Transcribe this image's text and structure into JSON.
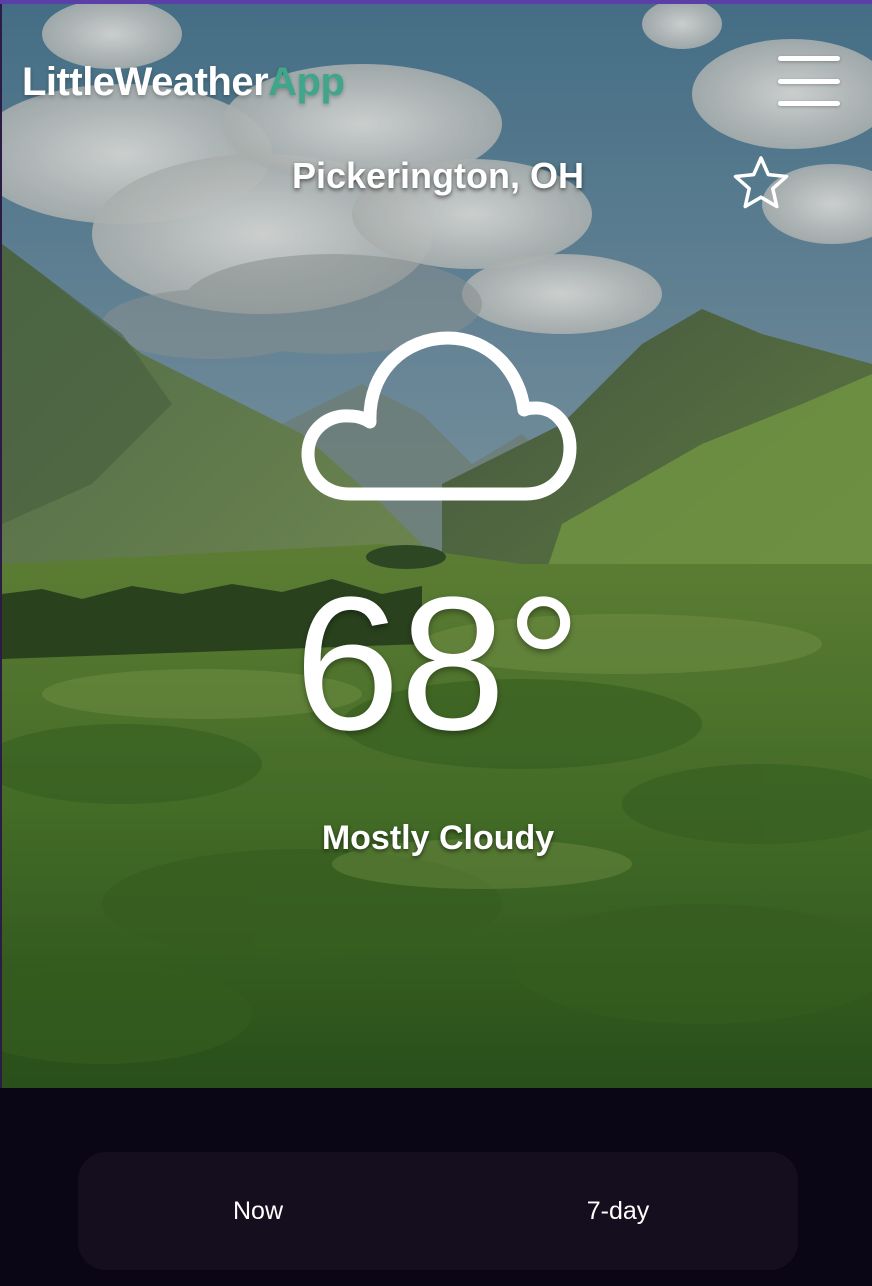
{
  "app": {
    "name_part1": "LittleWeather",
    "name_part2": "App",
    "brand_accent": "#3fa68b"
  },
  "header": {
    "menu_icon": "hamburger-menu-icon",
    "location": "Pickerington, OH",
    "favorite_icon": "star-outline-icon"
  },
  "current": {
    "condition_icon": "cloud-icon",
    "temperature": "68°",
    "condition": "Mostly Cloudy"
  },
  "tabs": [
    {
      "label": "Now"
    },
    {
      "label": "7-day"
    }
  ],
  "colors": {
    "top_bar": "#5b3fa8",
    "bottom_background": "#0b0616",
    "tab_bar_background": "#150e1e"
  }
}
